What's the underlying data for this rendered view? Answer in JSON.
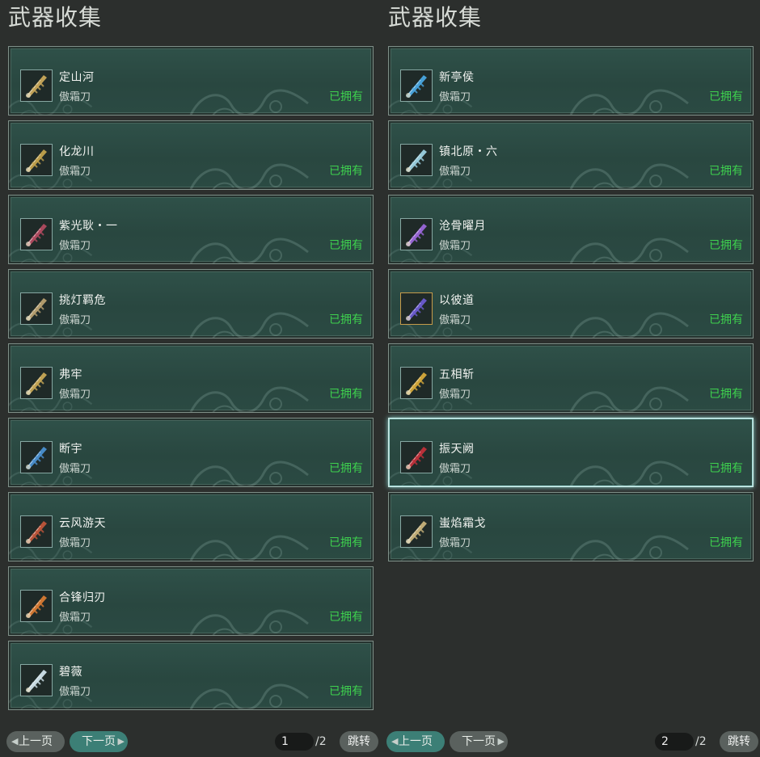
{
  "panels": [
    {
      "title": "武器收集",
      "items": [
        {
          "name": "定山河",
          "type": "傲霜刀",
          "status": "已拥有",
          "icon": "blade-gold-icon",
          "accent": "#c9a85a"
        },
        {
          "name": "化龙川",
          "type": "傲霜刀",
          "status": "已拥有",
          "icon": "blade-gold-icon",
          "accent": "#c2a24c"
        },
        {
          "name": "紫光耿・一",
          "type": "傲霜刀",
          "status": "已拥有",
          "icon": "blade-crimson-icon",
          "accent": "#b14a5f"
        },
        {
          "name": "挑灯羁危",
          "type": "傲霜刀",
          "status": "已拥有",
          "icon": "blade-bronze-icon",
          "accent": "#b8a070"
        },
        {
          "name": "弗牢",
          "type": "傲霜刀",
          "status": "已拥有",
          "icon": "blade-gold-icon",
          "accent": "#c7a855"
        },
        {
          "name": "断宇",
          "type": "傲霜刀",
          "status": "已拥有",
          "icon": "blade-blue-icon",
          "accent": "#4a8fcf"
        },
        {
          "name": "云风游天",
          "type": "傲霜刀",
          "status": "已拥有",
          "icon": "blade-red-icon",
          "accent": "#c0553a"
        },
        {
          "name": "合锋归刃",
          "type": "傲霜刀",
          "status": "已拥有",
          "icon": "blade-orange-icon",
          "accent": "#d87a33"
        },
        {
          "name": "碧薇",
          "type": "傲霜刀",
          "status": "已拥有",
          "icon": "blade-silver-icon",
          "accent": "#cfe2ea"
        }
      ],
      "footer": {
        "prev": "上一页",
        "next": "下一页",
        "page": "1",
        "total": "/2",
        "jump": "跳转",
        "active": "next"
      }
    },
    {
      "title": "武器收集",
      "items": [
        {
          "name": "新亭侯",
          "type": "傲霜刀",
          "status": "已拥有",
          "icon": "blade-blue-icon",
          "accent": "#4aa6e0"
        },
        {
          "name": "镇北原・六",
          "type": "傲霜刀",
          "status": "已拥有",
          "icon": "blade-silver-icon",
          "accent": "#9bd0e0"
        },
        {
          "name": "沧骨曜月",
          "type": "傲霜刀",
          "status": "已拥有",
          "icon": "blade-purple-icon",
          "accent": "#9a66d8"
        },
        {
          "name": "以彼道",
          "type": "傲霜刀",
          "status": "已拥有",
          "icon": "blade-violet-icon",
          "accent": "#6b5bd0",
          "gold": true
        },
        {
          "name": "五相斩",
          "type": "傲霜刀",
          "status": "已拥有",
          "icon": "blade-gold-icon",
          "accent": "#d6a93a"
        },
        {
          "name": "振天阙",
          "type": "傲霜刀",
          "status": "已拥有",
          "icon": "blade-crimson-icon",
          "accent": "#c0303a",
          "selected": true
        },
        {
          "name": "蚩焰霜戈",
          "type": "傲霜刀",
          "status": "已拥有",
          "icon": "blade-bronze-icon",
          "accent": "#c7b27a"
        }
      ],
      "footer": {
        "prev": "上一页",
        "next": "下一页",
        "page": "2",
        "total": "/2",
        "jump": "跳转",
        "active": "prev"
      }
    }
  ],
  "colors": {
    "owned": "#3ed14e",
    "card": "#2f5149",
    "background": "#2c2f2d"
  }
}
